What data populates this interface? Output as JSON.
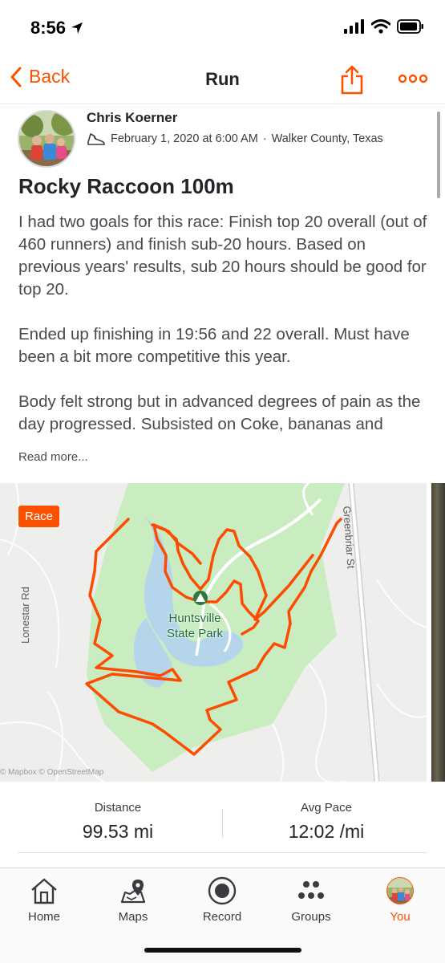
{
  "status_bar": {
    "time": "8:56"
  },
  "nav": {
    "back_label": "Back",
    "title": "Run"
  },
  "activity": {
    "athlete_name": "Chris Koerner",
    "date": "February 1, 2020 at 6:00 AM",
    "location": "Walker County, Texas",
    "separator": "·",
    "title": "Rocky Raccoon 100m",
    "description": [
      "I had two goals for this race: Finish top 20 overall (out of 460 runners) and finish sub-20 hours. Based on previous years' results, sub 20 hours should be good for top 20.",
      "Ended up finishing in 19:56 and 22 overall. Must have been a bit more competitive this year.",
      "Body felt strong but in advanced degrees of pain as the day progressed. Subsisted on Coke, bananas and"
    ],
    "read_more": "Read more..."
  },
  "map": {
    "badge": "Race",
    "park_name_line1": "Huntsville",
    "park_name_line2": "State Park",
    "road_west": "Lonestar Rd",
    "road_east": "Greenbriar St",
    "attribution": "© Mapbox © OpenStreetMap",
    "route_color": "#fc4c02",
    "park_color": "#c9ecc0",
    "water_color": "#b5d6ea"
  },
  "stats": [
    {
      "label": "Distance",
      "value": "99.53 mi"
    },
    {
      "label": "Avg Pace",
      "value": "12:02 /mi"
    }
  ],
  "tabs": [
    {
      "label": "Home",
      "icon": "home-icon"
    },
    {
      "label": "Maps",
      "icon": "maps-icon"
    },
    {
      "label": "Record",
      "icon": "record-icon"
    },
    {
      "label": "Groups",
      "icon": "groups-icon"
    },
    {
      "label": "You",
      "icon": "avatar-icon",
      "active": true
    }
  ],
  "colors": {
    "accent": "#fc5200",
    "text": "#242428",
    "muted": "#494950"
  }
}
